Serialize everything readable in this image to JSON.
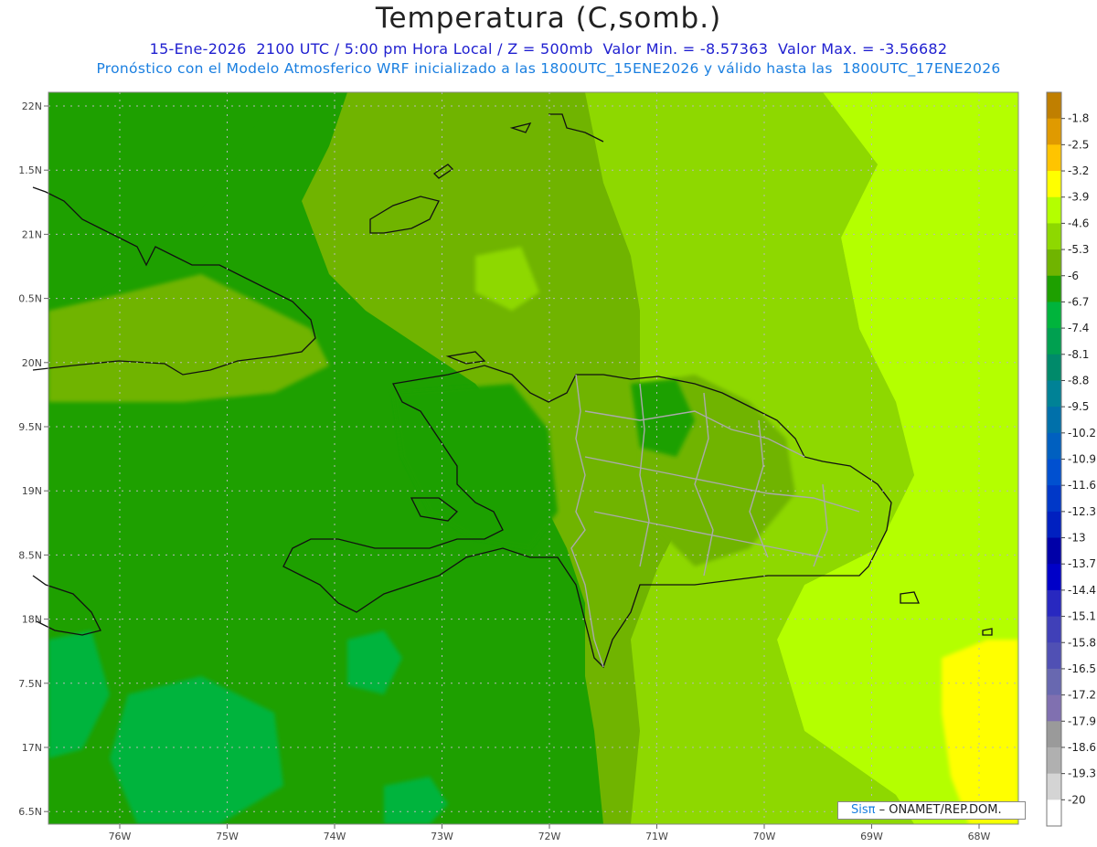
{
  "header": {
    "title": "Temperatura (C,somb.)",
    "subtitle_1": "15-Ene-2026  2100 UTC / 5:00 pm Hora Local / Z = 500mb  Valor Min. = -8.57363  Valor Max. = -3.56682",
    "subtitle_2": "Pronóstico con el Modelo Atmosferico WRF inicializado a las 1800UTC_15ENE2026 y válido hasta las  1800UTC_17ENE2026"
  },
  "map": {
    "lat_labels": [
      "22N",
      "1.5N",
      "21N",
      "0.5N",
      "20N",
      "9.5N",
      "19N",
      "8.5N",
      "18N",
      "7.5N",
      "17N",
      "6.5N"
    ],
    "lon_labels": [
      "76W",
      "75W",
      "74W",
      "73W",
      "72W",
      "71W",
      "70W",
      "69W",
      "68W"
    ],
    "min_value": -8.57363,
    "max_value": -3.56682,
    "grid": "dotted"
  },
  "colorbar": {
    "labels": [
      "-1.8",
      "-2.5",
      "-3.2",
      "-3.9",
      "-4.6",
      "-5.3",
      "-6",
      "-6.7",
      "-7.4",
      "-8.1",
      "-8.8",
      "-9.5",
      "-10.2",
      "-10.9",
      "-11.6",
      "-12.3",
      "-13",
      "-13.7",
      "-14.4",
      "-15.1",
      "-15.8",
      "-16.5",
      "-17.2",
      "-17.9",
      "-18.6",
      "-19.3",
      "-20"
    ],
    "colors": [
      "#c07f00",
      "#e09a00",
      "#ffc400",
      "#ffff00",
      "#b4ff00",
      "#8ed800",
      "#70b400",
      "#1ea000",
      "#00b43c",
      "#00a050",
      "#008a6a",
      "#008296",
      "#0070aa",
      "#0060c0",
      "#0050d0",
      "#0038c8",
      "#0020c0",
      "#0000a8",
      "#0000c8",
      "#2828c0",
      "#4040b8",
      "#5050b4",
      "#6868b0",
      "#8070b0",
      "#9a9a9a",
      "#b0b0b0",
      "#d4d4d4",
      "#ffffff"
    ]
  },
  "credit": {
    "logo_text": "Sisπ",
    "text": "– ONAMET/REP.DOM."
  }
}
